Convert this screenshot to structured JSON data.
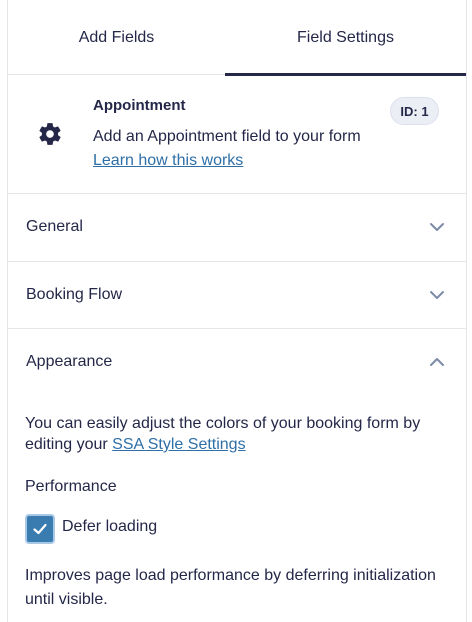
{
  "tabs": [
    {
      "label": "Add Fields"
    },
    {
      "label": "Field Settings"
    }
  ],
  "field": {
    "icon": "gear-icon",
    "title": "Appointment",
    "id_badge": "ID: 1",
    "description": "Add an Appointment field to your form",
    "learn_link": "Learn how this works"
  },
  "sections": {
    "general": {
      "label": "General",
      "expanded": false
    },
    "booking_flow": {
      "label": "Booking Flow",
      "expanded": false
    },
    "appearance": {
      "label": "Appearance",
      "expanded": true,
      "text_before": "You can easily adjust the colors of your booking form by editing your",
      "style_link": "SSA Style Settings",
      "performance_label": "Performance",
      "defer_label": "Defer loading",
      "defer_checked": true,
      "help_text": "Improves page load performance by deferring initialization until visible."
    }
  },
  "colors": {
    "text": "#242748",
    "link": "#2e6fa7",
    "checkbox": "#3a7cb0",
    "border": "#e6e6ea"
  }
}
